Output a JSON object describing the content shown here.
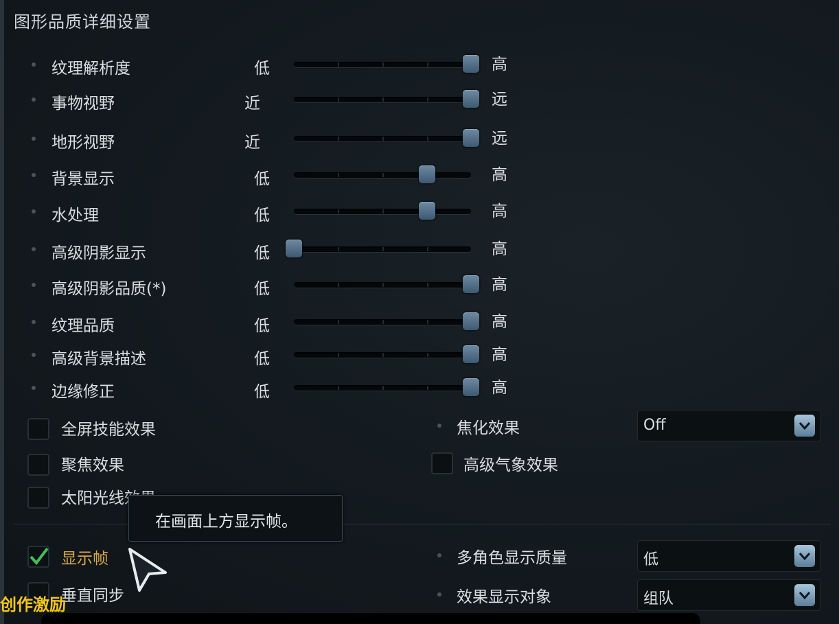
{
  "title": "图形品质详细设置",
  "sliders": [
    {
      "label": "纹理解析度",
      "low": "低",
      "high": "高",
      "value": 1.0
    },
    {
      "label": "事物视野",
      "low": "近",
      "high": "远",
      "value": 1.0
    },
    {
      "label": "地形视野",
      "low": "近",
      "high": "远",
      "value": 1.0
    },
    {
      "label": "背景显示",
      "low": "低",
      "high": "高",
      "value": 0.75
    },
    {
      "label": "水处理",
      "low": "低",
      "high": "高",
      "value": 0.75
    },
    {
      "label": "高级阴影显示",
      "low": "低",
      "high": "高",
      "value": 0.0
    },
    {
      "label": "高级阴影品质(*)",
      "low": "低",
      "high": "高",
      "value": 1.0
    },
    {
      "label": "纹理品质",
      "low": "低",
      "high": "高",
      "value": 1.0
    },
    {
      "label": "高级背景描述",
      "low": "低",
      "high": "高",
      "value": 1.0
    },
    {
      "label": "边缘修正",
      "low": "低",
      "high": "高",
      "value": 1.0
    }
  ],
  "checkboxes": {
    "fullscreen_skill": {
      "label": "全屏技能效果",
      "checked": false
    },
    "focus_effect": {
      "label": "聚焦效果",
      "checked": false
    },
    "sunlight": {
      "label": "太阳光线效果",
      "checked": false
    },
    "advanced_weather": {
      "label": "高级气象效果",
      "checked": false
    },
    "show_fps": {
      "label": "显示帧",
      "checked": true
    },
    "vsync": {
      "label": "垂直同步",
      "checked": false
    }
  },
  "dropdowns": {
    "focus": {
      "label": "焦化效果",
      "value": "Off"
    },
    "multi_char": {
      "label": "多角色显示质量",
      "value": "低"
    },
    "effect_target": {
      "label": "效果显示对象",
      "value": "组队"
    }
  },
  "tooltip": "在画面上方显示帧。",
  "watermark": "创作激励",
  "colors": {
    "accent_check": "#3fbf5a",
    "highlight_label": "#d8a64a",
    "watermark": "#f2c718"
  }
}
